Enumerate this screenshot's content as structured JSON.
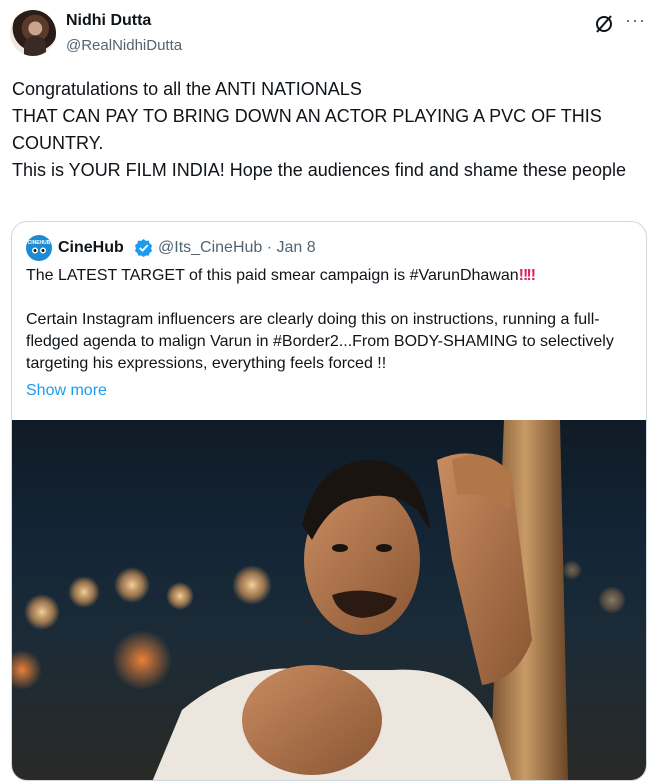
{
  "author": {
    "name": "Nidhi Dutta",
    "handle": "@RealNidhiDutta",
    "avatar_icon": "profile-photo"
  },
  "actions": {
    "grok_icon": "grok-icon",
    "more_label": "···"
  },
  "tweet": {
    "text": "Congratulations to all the ANTI NATIONALS\nTHAT CAN PAY TO BRING DOWN AN ACTOR PLAYING A PVC OF THIS COUNTRY.\nThis is YOUR FILM INDIA! Hope the audiences find and shame these people"
  },
  "quote": {
    "name": "CineHub",
    "avatar_brand": "CINEHUB",
    "handle_date": "@Its_CineHub · Jan 8",
    "line1": "The LATEST TARGET of this paid smear campaign is #VarunDhawan",
    "line1_emoji": "‼‼",
    "body": "Certain Instagram influencers are clearly doing this on instructions, running a full-fledged agenda to malign Varun in #Border2...From BODY-SHAMING to selectively targeting his expressions, everything feels forced !!",
    "show_more": "Show more",
    "image_subject": "man-in-white-tshirt-against-wooden-pole-night-bokeh"
  },
  "colors": {
    "link": "#1d9bf0",
    "secondary_text": "#536471",
    "border": "#cfd9de",
    "verified": "#1d9bf0"
  }
}
